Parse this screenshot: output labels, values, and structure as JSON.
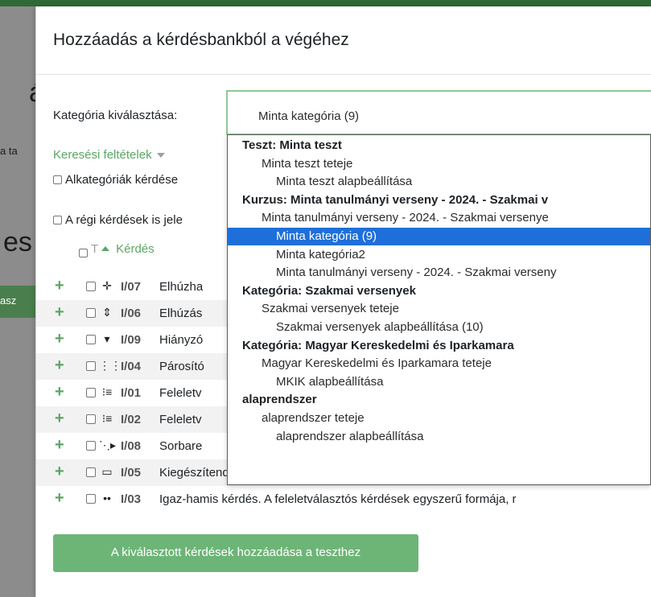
{
  "background": {
    "frag_a": "á",
    "frag_e": "es",
    "frag_ta": "a ta",
    "frag_asz": "asz"
  },
  "modal": {
    "title": "Hozzáadás a kérdésbankból a végéhez",
    "category_label": "Kategória kiválasztása:",
    "category_value": "Minta kategória (9)",
    "search_toggle": "Keresési feltételek",
    "subcat_checkbox": "Alkategóriák kérdése",
    "old_questions_checkbox": "A régi kérdések is jele",
    "table_header": {
      "type_col": "T",
      "question_col": "Kérdés"
    },
    "questions": [
      {
        "icon": "drag-drop-icon",
        "glyph": "✛",
        "code": "I/07",
        "text": "Elhúzha"
      },
      {
        "icon": "drag-drop-small-icon",
        "glyph": "⇕",
        "code": "I/06",
        "text": "Elhúzás"
      },
      {
        "icon": "dropdown-icon",
        "glyph": "▾",
        "code": "I/09",
        "text": "Hiányzó"
      },
      {
        "icon": "matching-icon",
        "glyph": "⋮⋮",
        "code": "I/04",
        "text": "Párosító"
      },
      {
        "icon": "multichoice-icon",
        "glyph": "⁝≡",
        "code": "I/01",
        "text": "Feleletv"
      },
      {
        "icon": "multichoice-icon",
        "glyph": "⁝≡",
        "code": "I/02",
        "text": "Feleletv"
      },
      {
        "icon": "ordering-icon",
        "glyph": "⋱▸",
        "code": "I/08",
        "text": "Sorbare"
      },
      {
        "icon": "short-answer-icon",
        "glyph": "▭",
        "code": "I/05",
        "text": "Kiegészítendő kérdés. Lehetővé teszi egy vagy több szóból álló vá"
      },
      {
        "icon": "true-false-icon",
        "glyph": "••",
        "code": "I/03",
        "text": "Igaz-hamis kérdés. A feleletválasztós kérdések egyszerű formája, r"
      }
    ],
    "add_button": "A kiválasztott kérdések hozzáadása a teszthez"
  },
  "listbox": {
    "options": [
      {
        "text": "Teszt: Minta teszt",
        "kind": "group",
        "indent": 0
      },
      {
        "text": "Minta teszt teteje",
        "kind": "option",
        "indent": 1
      },
      {
        "text": "Minta teszt alapbeállítása",
        "kind": "option",
        "indent": 2
      },
      {
        "text": "Kurzus: Minta tanulmányi verseny - 2024. - Szakmai v",
        "kind": "group",
        "indent": 0
      },
      {
        "text": "Minta tanulmányi verseny - 2024. - Szakmai versenye",
        "kind": "option",
        "indent": 1
      },
      {
        "text": "Minta kategória (9)",
        "kind": "selected",
        "indent": 2
      },
      {
        "text": "Minta kategória2",
        "kind": "option",
        "indent": 2
      },
      {
        "text": "Minta tanulmányi verseny - 2024. - Szakmai verseny",
        "kind": "option",
        "indent": 2
      },
      {
        "text": "Kategória: Szakmai versenyek",
        "kind": "group",
        "indent": 0
      },
      {
        "text": "Szakmai versenyek teteje",
        "kind": "option",
        "indent": 1
      },
      {
        "text": "Szakmai versenyek alapbeállítása (10)",
        "kind": "option",
        "indent": 2
      },
      {
        "text": "Kategória: Magyar Kereskedelmi és Iparkamara",
        "kind": "group",
        "indent": 0
      },
      {
        "text": "Magyar Kereskedelmi és Iparkamara teteje",
        "kind": "option",
        "indent": 1
      },
      {
        "text": "MKIK alapbeállítása",
        "kind": "option",
        "indent": 2
      },
      {
        "text": "alaprendszer",
        "kind": "group",
        "indent": 0
      },
      {
        "text": "alaprendszer teteje",
        "kind": "option",
        "indent": 1
      },
      {
        "text": "alaprendszer alapbeállítása",
        "kind": "option",
        "indent": 2
      }
    ],
    "selected_color": "#1e6fd9"
  },
  "colors": {
    "accent_green": "#5ba665",
    "button_green": "#6db577"
  }
}
